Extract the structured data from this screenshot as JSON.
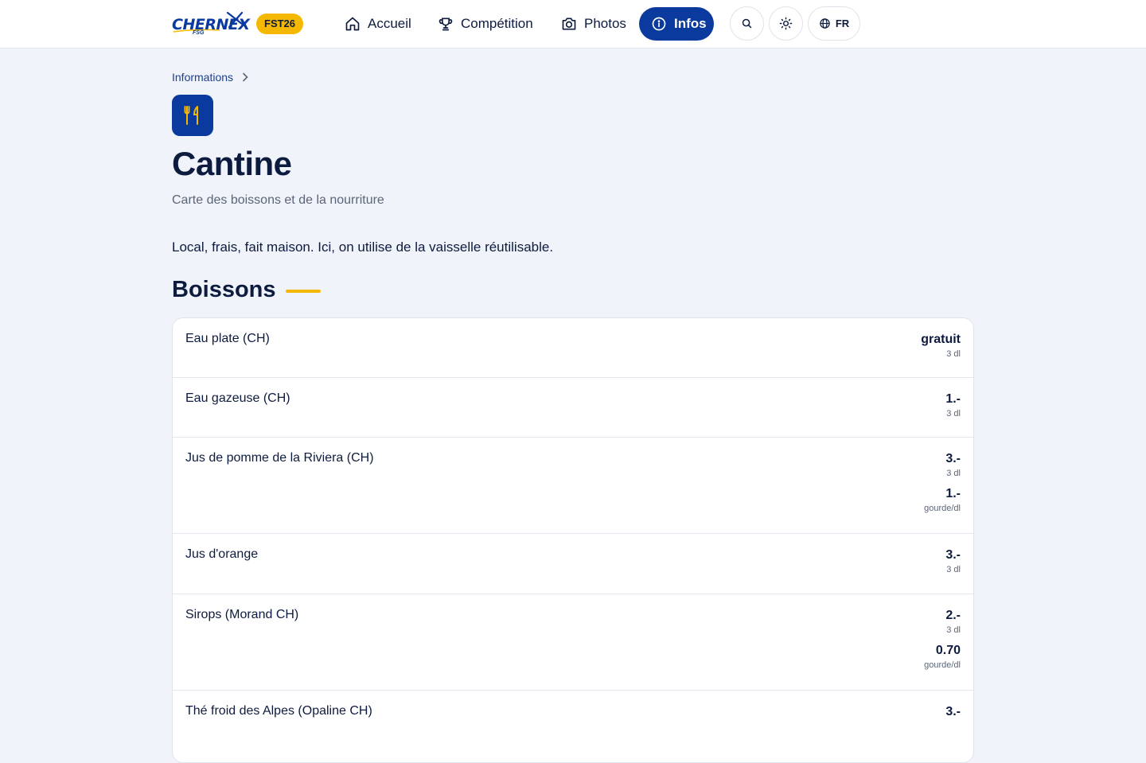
{
  "header": {
    "logo": "CHERNEX",
    "logo_sub": "FSG",
    "badge": "FST26",
    "nav": {
      "home": "Accueil",
      "competition": "Compétition",
      "photos": "Photos",
      "infos": "Infos"
    },
    "language": "FR"
  },
  "breadcrumb": "Informations",
  "page": {
    "title": "Cantine",
    "subtitle": "Carte des boissons et de la nourriture",
    "intro": "Local, frais, fait maison. Ici, on utilise de la vaisselle réutilisable."
  },
  "section": {
    "title": "Boissons",
    "items": [
      {
        "name": "Eau plate (CH)",
        "prices": [
          {
            "price": "gratuit",
            "unit": "3 dl"
          }
        ]
      },
      {
        "name": "Eau gazeuse (CH)",
        "prices": [
          {
            "price": "1.-",
            "unit": "3 dl"
          }
        ]
      },
      {
        "name": "Jus de pomme de la Riviera (CH)",
        "prices": [
          {
            "price": "3.-",
            "unit": "3 dl"
          },
          {
            "price": "1.-",
            "unit": "gourde/dl"
          }
        ]
      },
      {
        "name": "Jus d'orange",
        "prices": [
          {
            "price": "3.-",
            "unit": "3 dl"
          }
        ]
      },
      {
        "name": "Sirops (Morand CH)",
        "prices": [
          {
            "price": "2.-",
            "unit": "3 dl"
          },
          {
            "price": "0.70",
            "unit": "gourde/dl"
          }
        ]
      },
      {
        "name": "Thé froid des Alpes (Opaline CH)",
        "prices": [
          {
            "price": "3.-",
            "unit": ""
          }
        ]
      }
    ]
  },
  "colors": {
    "primary": "#0a3a9e",
    "accent": "#f5b800",
    "background": "#f0f3fa"
  }
}
